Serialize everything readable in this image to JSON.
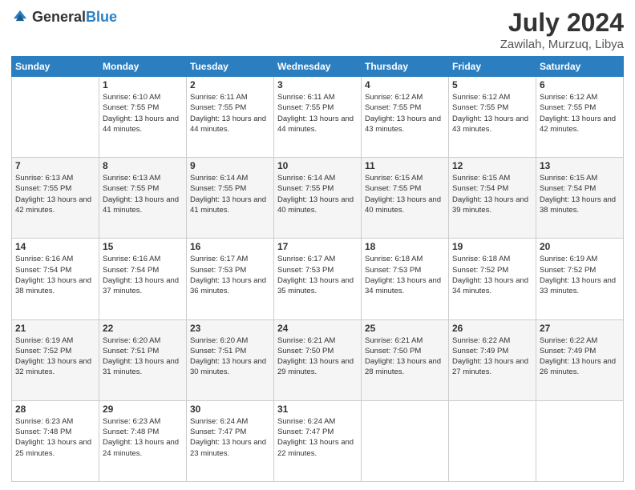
{
  "header": {
    "logo_general": "General",
    "logo_blue": "Blue",
    "month": "July 2024",
    "location": "Zawilah, Murzuq, Libya"
  },
  "days_of_week": [
    "Sunday",
    "Monday",
    "Tuesday",
    "Wednesday",
    "Thursday",
    "Friday",
    "Saturday"
  ],
  "weeks": [
    [
      {
        "day": "",
        "sunrise": "",
        "sunset": "",
        "daylight": ""
      },
      {
        "day": "1",
        "sunrise": "Sunrise: 6:10 AM",
        "sunset": "Sunset: 7:55 PM",
        "daylight": "Daylight: 13 hours and 44 minutes."
      },
      {
        "day": "2",
        "sunrise": "Sunrise: 6:11 AM",
        "sunset": "Sunset: 7:55 PM",
        "daylight": "Daylight: 13 hours and 44 minutes."
      },
      {
        "day": "3",
        "sunrise": "Sunrise: 6:11 AM",
        "sunset": "Sunset: 7:55 PM",
        "daylight": "Daylight: 13 hours and 44 minutes."
      },
      {
        "day": "4",
        "sunrise": "Sunrise: 6:12 AM",
        "sunset": "Sunset: 7:55 PM",
        "daylight": "Daylight: 13 hours and 43 minutes."
      },
      {
        "day": "5",
        "sunrise": "Sunrise: 6:12 AM",
        "sunset": "Sunset: 7:55 PM",
        "daylight": "Daylight: 13 hours and 43 minutes."
      },
      {
        "day": "6",
        "sunrise": "Sunrise: 6:12 AM",
        "sunset": "Sunset: 7:55 PM",
        "daylight": "Daylight: 13 hours and 42 minutes."
      }
    ],
    [
      {
        "day": "7",
        "sunrise": "Sunrise: 6:13 AM",
        "sunset": "Sunset: 7:55 PM",
        "daylight": "Daylight: 13 hours and 42 minutes."
      },
      {
        "day": "8",
        "sunrise": "Sunrise: 6:13 AM",
        "sunset": "Sunset: 7:55 PM",
        "daylight": "Daylight: 13 hours and 41 minutes."
      },
      {
        "day": "9",
        "sunrise": "Sunrise: 6:14 AM",
        "sunset": "Sunset: 7:55 PM",
        "daylight": "Daylight: 13 hours and 41 minutes."
      },
      {
        "day": "10",
        "sunrise": "Sunrise: 6:14 AM",
        "sunset": "Sunset: 7:55 PM",
        "daylight": "Daylight: 13 hours and 40 minutes."
      },
      {
        "day": "11",
        "sunrise": "Sunrise: 6:15 AM",
        "sunset": "Sunset: 7:55 PM",
        "daylight": "Daylight: 13 hours and 40 minutes."
      },
      {
        "day": "12",
        "sunrise": "Sunrise: 6:15 AM",
        "sunset": "Sunset: 7:54 PM",
        "daylight": "Daylight: 13 hours and 39 minutes."
      },
      {
        "day": "13",
        "sunrise": "Sunrise: 6:15 AM",
        "sunset": "Sunset: 7:54 PM",
        "daylight": "Daylight: 13 hours and 38 minutes."
      }
    ],
    [
      {
        "day": "14",
        "sunrise": "Sunrise: 6:16 AM",
        "sunset": "Sunset: 7:54 PM",
        "daylight": "Daylight: 13 hours and 38 minutes."
      },
      {
        "day": "15",
        "sunrise": "Sunrise: 6:16 AM",
        "sunset": "Sunset: 7:54 PM",
        "daylight": "Daylight: 13 hours and 37 minutes."
      },
      {
        "day": "16",
        "sunrise": "Sunrise: 6:17 AM",
        "sunset": "Sunset: 7:53 PM",
        "daylight": "Daylight: 13 hours and 36 minutes."
      },
      {
        "day": "17",
        "sunrise": "Sunrise: 6:17 AM",
        "sunset": "Sunset: 7:53 PM",
        "daylight": "Daylight: 13 hours and 35 minutes."
      },
      {
        "day": "18",
        "sunrise": "Sunrise: 6:18 AM",
        "sunset": "Sunset: 7:53 PM",
        "daylight": "Daylight: 13 hours and 34 minutes."
      },
      {
        "day": "19",
        "sunrise": "Sunrise: 6:18 AM",
        "sunset": "Sunset: 7:52 PM",
        "daylight": "Daylight: 13 hours and 34 minutes."
      },
      {
        "day": "20",
        "sunrise": "Sunrise: 6:19 AM",
        "sunset": "Sunset: 7:52 PM",
        "daylight": "Daylight: 13 hours and 33 minutes."
      }
    ],
    [
      {
        "day": "21",
        "sunrise": "Sunrise: 6:19 AM",
        "sunset": "Sunset: 7:52 PM",
        "daylight": "Daylight: 13 hours and 32 minutes."
      },
      {
        "day": "22",
        "sunrise": "Sunrise: 6:20 AM",
        "sunset": "Sunset: 7:51 PM",
        "daylight": "Daylight: 13 hours and 31 minutes."
      },
      {
        "day": "23",
        "sunrise": "Sunrise: 6:20 AM",
        "sunset": "Sunset: 7:51 PM",
        "daylight": "Daylight: 13 hours and 30 minutes."
      },
      {
        "day": "24",
        "sunrise": "Sunrise: 6:21 AM",
        "sunset": "Sunset: 7:50 PM",
        "daylight": "Daylight: 13 hours and 29 minutes."
      },
      {
        "day": "25",
        "sunrise": "Sunrise: 6:21 AM",
        "sunset": "Sunset: 7:50 PM",
        "daylight": "Daylight: 13 hours and 28 minutes."
      },
      {
        "day": "26",
        "sunrise": "Sunrise: 6:22 AM",
        "sunset": "Sunset: 7:49 PM",
        "daylight": "Daylight: 13 hours and 27 minutes."
      },
      {
        "day": "27",
        "sunrise": "Sunrise: 6:22 AM",
        "sunset": "Sunset: 7:49 PM",
        "daylight": "Daylight: 13 hours and 26 minutes."
      }
    ],
    [
      {
        "day": "28",
        "sunrise": "Sunrise: 6:23 AM",
        "sunset": "Sunset: 7:48 PM",
        "daylight": "Daylight: 13 hours and 25 minutes."
      },
      {
        "day": "29",
        "sunrise": "Sunrise: 6:23 AM",
        "sunset": "Sunset: 7:48 PM",
        "daylight": "Daylight: 13 hours and 24 minutes."
      },
      {
        "day": "30",
        "sunrise": "Sunrise: 6:24 AM",
        "sunset": "Sunset: 7:47 PM",
        "daylight": "Daylight: 13 hours and 23 minutes."
      },
      {
        "day": "31",
        "sunrise": "Sunrise: 6:24 AM",
        "sunset": "Sunset: 7:47 PM",
        "daylight": "Daylight: 13 hours and 22 minutes."
      },
      {
        "day": "",
        "sunrise": "",
        "sunset": "",
        "daylight": ""
      },
      {
        "day": "",
        "sunrise": "",
        "sunset": "",
        "daylight": ""
      },
      {
        "day": "",
        "sunrise": "",
        "sunset": "",
        "daylight": ""
      }
    ]
  ]
}
